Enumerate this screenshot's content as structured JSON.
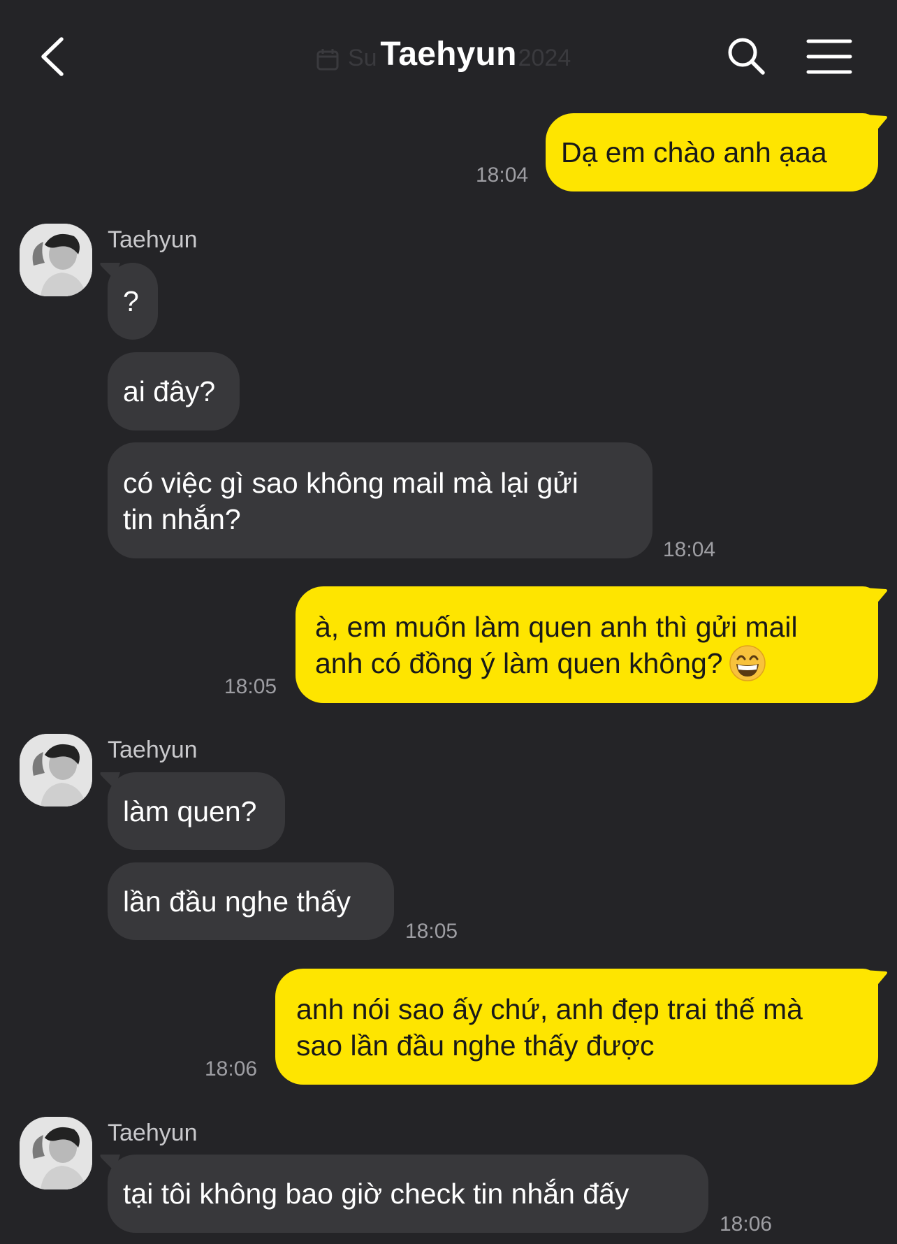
{
  "header": {
    "title": "Taehyun",
    "date_left": "Su",
    "date_right": "2024",
    "back_icon": "chevron-left-icon",
    "search_icon": "search-icon",
    "menu_icon": "hamburger-menu-icon"
  },
  "colors": {
    "background": "#242427",
    "outgoing_bubble": "#fee500",
    "incoming_bubble": "#38383b",
    "timestamp": "#9e9ea3"
  },
  "messages": [
    {
      "direction": "out",
      "text": "Dạ em chào anh ạaa",
      "time": "18:04"
    },
    {
      "direction": "in",
      "sender": "Taehyun",
      "text": "?"
    },
    {
      "direction": "in",
      "text": "ai đây?"
    },
    {
      "direction": "in",
      "line1": "có việc gì sao không mail mà lại gửi",
      "line2": "tin nhắn?",
      "time": "18:04"
    },
    {
      "direction": "out",
      "line1": "à, em muốn làm quen anh thì gửi mail",
      "line2": "anh có đồng ý làm quen không?",
      "emoji": "grinning-face-emoji",
      "time": "18:05"
    },
    {
      "direction": "in",
      "sender": "Taehyun",
      "text": "làm quen?"
    },
    {
      "direction": "in",
      "text": "lần đầu nghe thấy",
      "time": "18:05"
    },
    {
      "direction": "out",
      "line1": "anh nói sao ấy chứ, anh đẹp trai thế mà",
      "line2": "sao lần đầu nghe thấy được",
      "time": "18:06"
    },
    {
      "direction": "in",
      "sender": "Taehyun",
      "text": "tại tôi không bao giờ check tin nhắn đấy",
      "time": "18:06"
    }
  ]
}
